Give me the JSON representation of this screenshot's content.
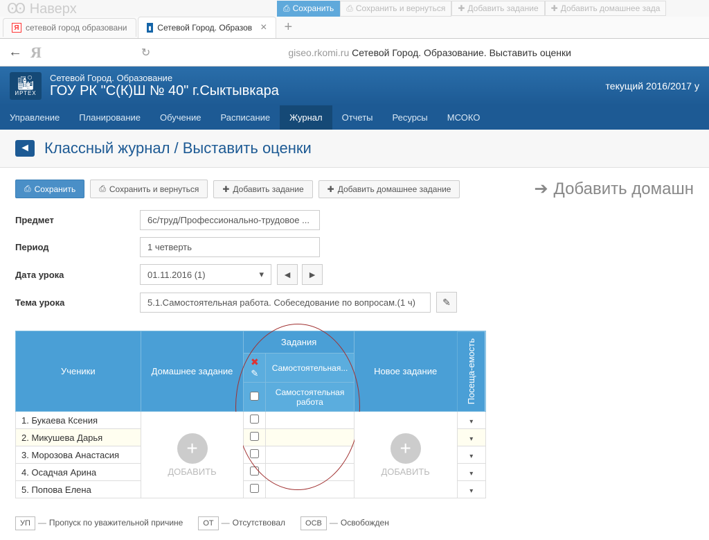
{
  "faded": {
    "naverh": "Ꙭ Наверх",
    "save": "Сохранить",
    "save_return": "Сохранить и вернуться",
    "add_task": "Добавить задание",
    "add_hw": "Добавить домашнее зада"
  },
  "tabs": {
    "t1": "сетевой город образовани",
    "t2": "Сетевой Город. Образов"
  },
  "addr": {
    "domain": "giseo.rkomi.ru",
    "title": " Сетевой Город. Образование. Выставить оценки"
  },
  "header": {
    "small": "Сетевой Город. Образование",
    "big": "ГОУ РК \"С(К)Ш № 40\" г.Сыктывкара",
    "year": "текущий 2016/2017 у",
    "logo": "ИРТЕХ"
  },
  "nav": {
    "i1": "Управление",
    "i2": "Планирование",
    "i3": "Обучение",
    "i4": "Расписание",
    "i5": "Журнал",
    "i6": "Отчеты",
    "i7": "Ресурсы",
    "i8": "МСОКО"
  },
  "crumb": "Классный журнал / Выставить оценки",
  "buttons": {
    "save": "Сохранить",
    "save_return": "Сохранить и вернуться",
    "add_task": "Добавить задание",
    "add_hw": "Добавить домашнее задание"
  },
  "side_heading": "Добавить домашн",
  "form": {
    "subject_l": "Предмет",
    "subject_v": "6с/труд/Профессионально-трудовое ...",
    "period_l": "Период",
    "period_v": "1 четверть",
    "date_l": "Дата урока",
    "date_v": "01.11.2016 (1)",
    "topic_l": "Тема урока",
    "topic_v": "5.1.Самостоятельная работа. Собеседование по вопросам.(1 ч)"
  },
  "grid": {
    "students_h": "Ученики",
    "hw_h": "Домашнее задание",
    "tasks_h": "Задания",
    "task_name": "Самостоятельная...",
    "task_sub": "Самостоятельная работа",
    "new_task_h": "Новое задание",
    "attendance_h": "Посеща-емость",
    "add_label": "ДОБАВИТЬ",
    "rows": {
      "r1": "1. Букаева Ксения",
      "r2": "2. Микушева Дарья",
      "r3": "3. Морозова Анастасия",
      "r4": "4. Осадчая Арина",
      "r5": "5. Попова Елена"
    }
  },
  "legend": {
    "up": "УП",
    "up_t": "Пропуск по уважительной причине",
    "ot": "ОТ",
    "ot_t": "Отсутствовал",
    "osv": "ОСВ",
    "osv_t": "Освобожден"
  }
}
